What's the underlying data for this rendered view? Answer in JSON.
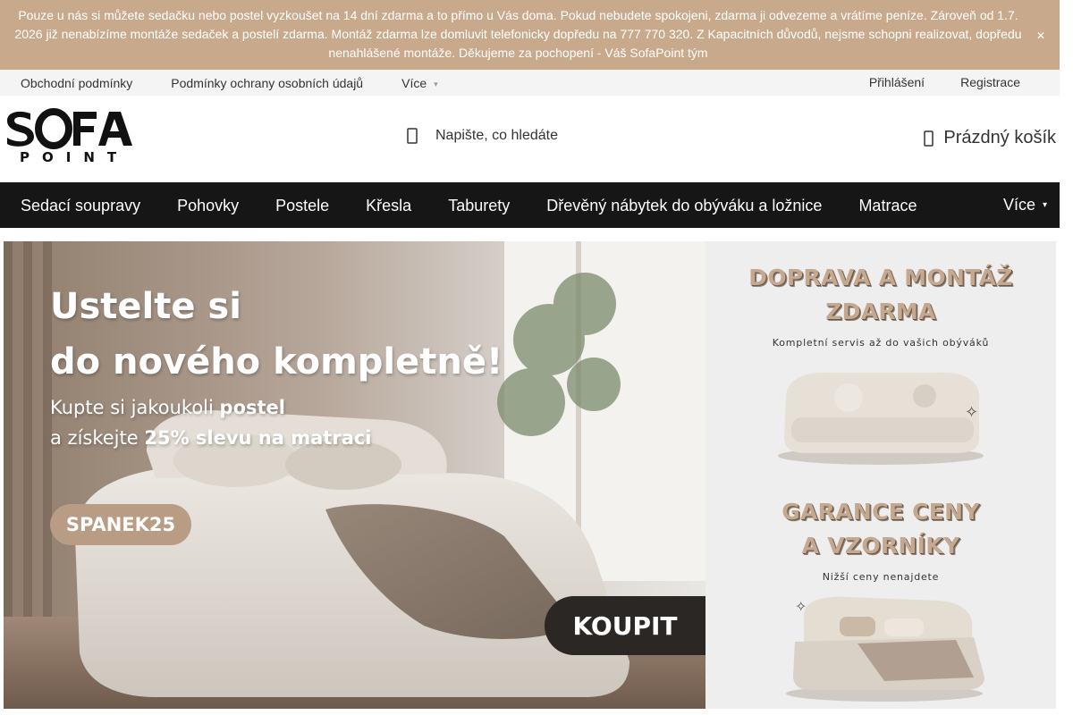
{
  "announcement": {
    "text": "Pouze u nás si můžete sedačku nebo postel vyzkoušet na 14 dní zdarma a to přímo u Vás doma. Pokud nebudete spokojeni, zdarma ji odvezeme a vrátíme peníze. Zároveň od 1.7. 2026 již nenabízíme montáže sedaček a postelí zdarma. Montáž zdarma lze domluvit telefonicky dopředu na 777 770 320. Z Kapacitních důvodů, nejsme schopni realizovat, dopředu nenahlášené montáže. Děkujeme za pochopení - Váš SofaPoint tým",
    "close_icon": "close-icon",
    "bg_color": "#c8a98b"
  },
  "toplinks": {
    "left": [
      "Obchodní podmínky",
      "Podmínky ochrany osobních údajů"
    ],
    "more_label": "Více",
    "login": "Přihlášení",
    "register": "Registrace"
  },
  "header": {
    "logo_alt": "SOFA POINT",
    "search_placeholder": "Napište, co hledáte",
    "cart_label": "Prázdný košík"
  },
  "nav": {
    "items": [
      "Sedací soupravy",
      "Pohovky",
      "Postele",
      "Křesla",
      "Taburety",
      "Dřevěný nábytek do obýváku a ložnice",
      "Matrace"
    ],
    "more_label": "Více"
  },
  "banner": {
    "left": {
      "headline1": "Ustelte si",
      "headline2": "do nového kompletně!",
      "sub1_pre": "Kupte si jakoukoli ",
      "sub1_bold": "postel",
      "sub2_pre": "a získejte ",
      "sub2_bold": "25% slevu na matraci",
      "code": "SPANEK25",
      "cta": "KOUPIT"
    },
    "right": {
      "title1a": "DOPRAVA A MONTÁŽ",
      "title1b": "ZDARMA",
      "sub1": "Kompletní servis až do vašich obýváků",
      "title2a": "GARANCE CENY",
      "title2b": "A VZORNÍKY",
      "sub2": "Nižší ceny nenajdete"
    }
  }
}
